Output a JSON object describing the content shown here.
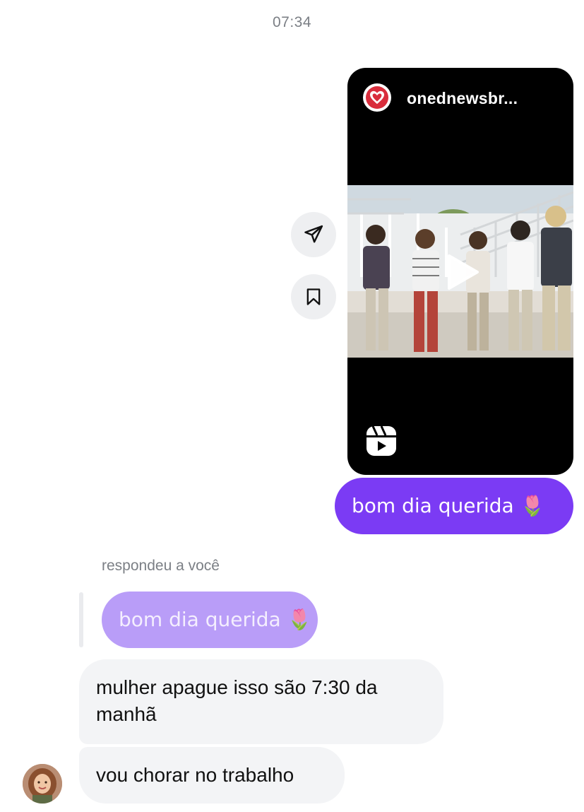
{
  "header": {
    "timestamp": "07:34"
  },
  "shared_reel": {
    "username": "onednewsbr...",
    "avatar_icon": "onednewsbr-logo-icon",
    "thumbnail": "video-thumbnail",
    "play_icon": "play-icon",
    "reels_icon": "reels-icon"
  },
  "side_actions": {
    "share_icon": "send-icon",
    "save_icon": "bookmark-icon"
  },
  "messages": {
    "sent": "bom dia querida 🌷",
    "reply_caption": "respondeu a você",
    "quoted": "bom dia querida 🌷",
    "received_1": "mulher apague isso são 7:30 da manhã",
    "received_2": "vou chorar no trabalho"
  },
  "colors": {
    "sent_bubble": "#7b3bf4",
    "quoted_bubble": "#b99df8",
    "received_bubble": "#f3f4f6",
    "timestamp_text": "#7b7f85"
  }
}
